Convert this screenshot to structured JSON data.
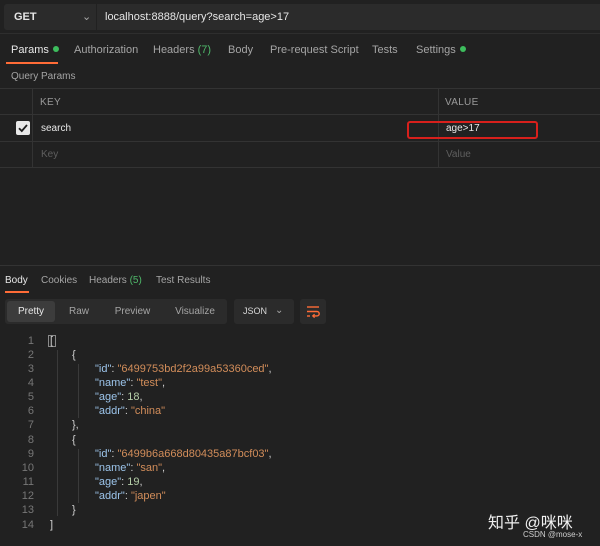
{
  "request": {
    "method": "GET",
    "url": "localhost:8888/query?search=age>17"
  },
  "request_tabs": {
    "params": "Params",
    "authorization": "Authorization",
    "headers": "Headers",
    "headers_count": "(7)",
    "body": "Body",
    "pre_request": "Pre-request Script",
    "tests": "Tests",
    "settings": "Settings"
  },
  "query_params": {
    "title": "Query Params",
    "key_header": "KEY",
    "value_header": "VALUE",
    "rows": [
      {
        "checked": true,
        "key": "search",
        "value": "age>17"
      }
    ],
    "key_placeholder": "Key",
    "value_placeholder": "Value"
  },
  "response_tabs": {
    "body": "Body",
    "cookies": "Cookies",
    "headers": "Headers",
    "headers_count": "(5)",
    "test_results": "Test Results"
  },
  "view_modes": {
    "pretty": "Pretty",
    "raw": "Raw",
    "preview": "Preview",
    "visualize": "Visualize",
    "format": "JSON"
  },
  "response_body": {
    "line_numbers": [
      "1",
      "2",
      "3",
      "4",
      "5",
      "6",
      "7",
      "8",
      "9",
      "10",
      "11",
      "12",
      "13",
      "14"
    ],
    "records": [
      {
        "id": "\"6499753bd2f2a99a53360ced\"",
        "name": "\"test\"",
        "age": "18",
        "addr": "\"china\""
      },
      {
        "id": "\"6499b6a668d80435a87bcf03\"",
        "name": "\"san\"",
        "age": "19",
        "addr": "\"japen\""
      }
    ],
    "keys": {
      "id": "\"id\"",
      "name": "\"name\"",
      "age": "\"age\"",
      "addr": "\"addr\""
    }
  },
  "watermark": {
    "main": "知乎 @咪咪",
    "sub": "CSDN @mose-x"
  },
  "colors": {
    "accent": "#ff6c37",
    "status_dot": "#3dbd5d",
    "highlight_box": "#d8201c"
  }
}
